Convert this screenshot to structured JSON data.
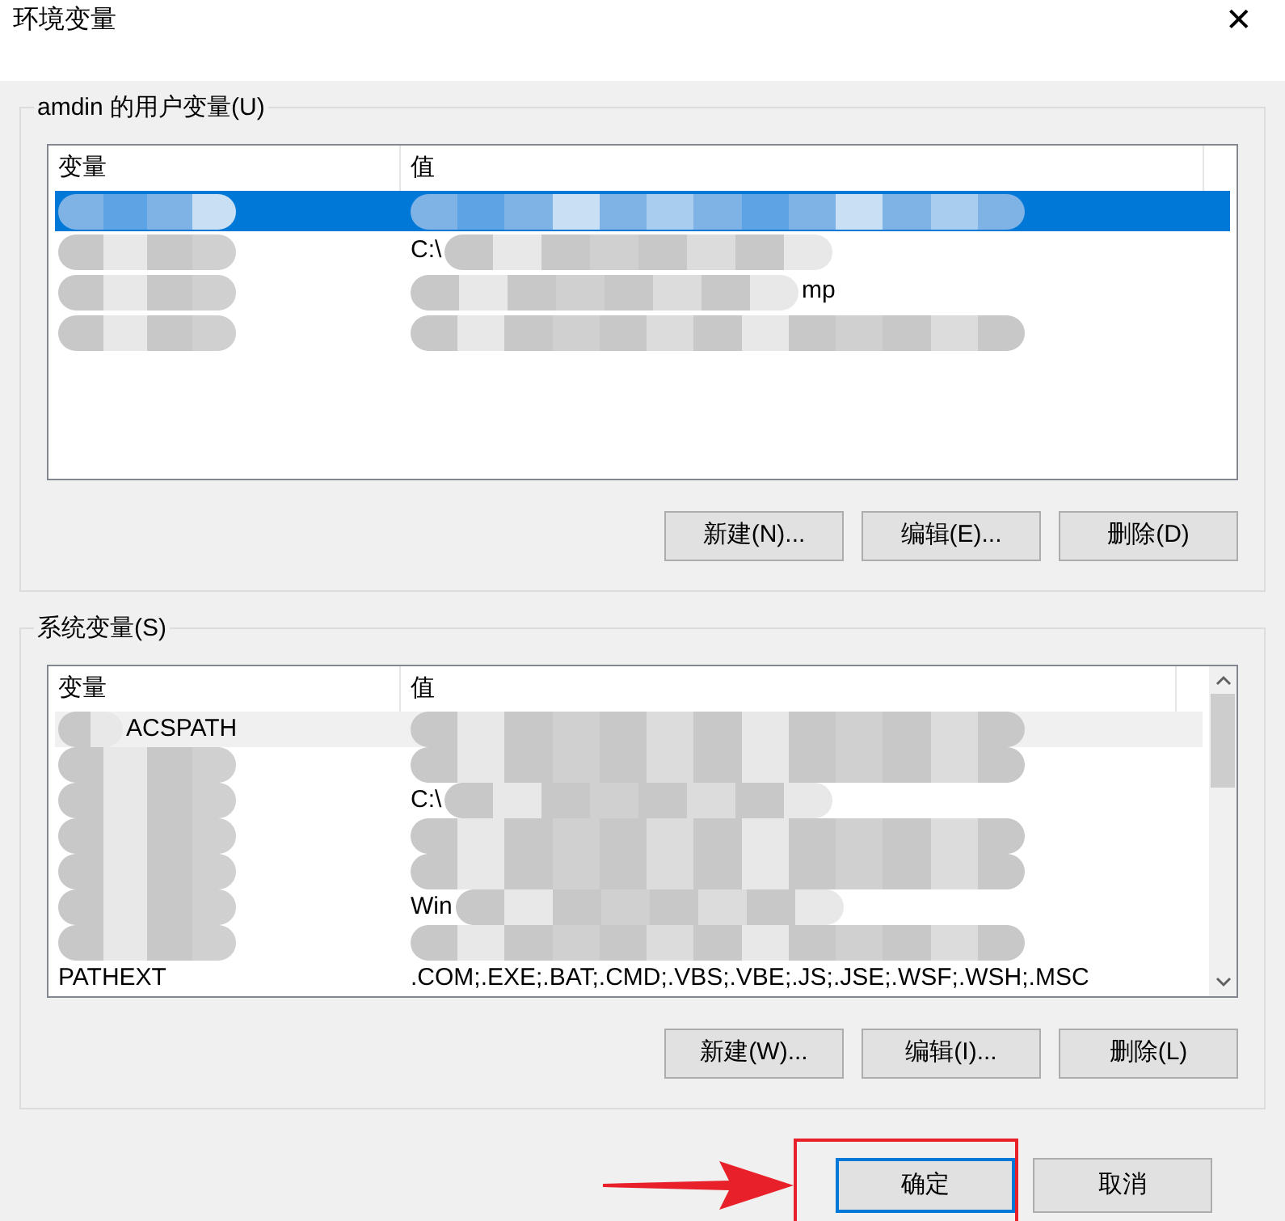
{
  "window": {
    "title": "环境变量",
    "close": "✕"
  },
  "user_group": {
    "title": "amdin 的用户变量(U)",
    "columns": [
      "变量",
      "值"
    ],
    "rows": [
      {
        "selected": true,
        "name": [
          {
            "kind": "redaction"
          }
        ],
        "value": [
          {
            "kind": "redaction"
          }
        ]
      },
      {
        "selected": false,
        "name": [
          {
            "kind": "redaction"
          }
        ],
        "value": [
          {
            "kind": "text",
            "text": "C:\\"
          },
          {
            "kind": "redaction"
          }
        ]
      },
      {
        "selected": false,
        "name": [
          {
            "kind": "redaction"
          }
        ],
        "value": [
          {
            "kind": "redaction"
          },
          {
            "kind": "text",
            "text": "mp"
          }
        ]
      },
      {
        "selected": false,
        "name": [
          {
            "kind": "redaction"
          }
        ],
        "value": [
          {
            "kind": "redaction"
          }
        ]
      }
    ],
    "buttons": [
      "新建(N)...",
      "编辑(E)...",
      "删除(D)"
    ]
  },
  "system_group": {
    "title": "系统变量(S)",
    "columns": [
      "变量",
      "值"
    ],
    "rows": [
      {
        "selected": true,
        "name": [
          {
            "kind": "redaction"
          },
          {
            "kind": "text",
            "text": "ACSPATH"
          }
        ],
        "value": [
          {
            "kind": "redaction"
          }
        ]
      },
      {
        "selected": false,
        "name": [
          {
            "kind": "redaction"
          }
        ],
        "value": [
          {
            "kind": "redaction"
          }
        ]
      },
      {
        "selected": false,
        "name": [
          {
            "kind": "redaction"
          }
        ],
        "value": [
          {
            "kind": "text",
            "text": "C:\\"
          },
          {
            "kind": "redaction"
          }
        ]
      },
      {
        "selected": false,
        "name": [
          {
            "kind": "redaction"
          }
        ],
        "value": [
          {
            "kind": "redaction"
          }
        ]
      },
      {
        "selected": false,
        "name": [
          {
            "kind": "redaction"
          }
        ],
        "value": [
          {
            "kind": "redaction"
          }
        ]
      },
      {
        "selected": false,
        "name": [
          {
            "kind": "redaction"
          }
        ],
        "value": [
          {
            "kind": "text",
            "text": "Win"
          },
          {
            "kind": "redaction"
          }
        ]
      },
      {
        "selected": false,
        "name": [
          {
            "kind": "redaction"
          }
        ],
        "value": [
          {
            "kind": "redaction"
          }
        ]
      },
      {
        "selected": false,
        "name": [
          {
            "kind": "text",
            "text": "PATHEXT"
          }
        ],
        "value": [
          {
            "kind": "text",
            "text": ".COM;.EXE;.BAT;.CMD;.VBS;.VBE;.JS;.JSE;.WSF;.WSH;.MSC"
          }
        ]
      }
    ],
    "buttons": [
      "新建(W)...",
      "编辑(I)...",
      "删除(L)"
    ]
  },
  "footer_buttons": [
    {
      "label": "确定",
      "default": true,
      "highlighted": true
    },
    {
      "label": "取消",
      "default": false,
      "highlighted": false
    }
  ]
}
